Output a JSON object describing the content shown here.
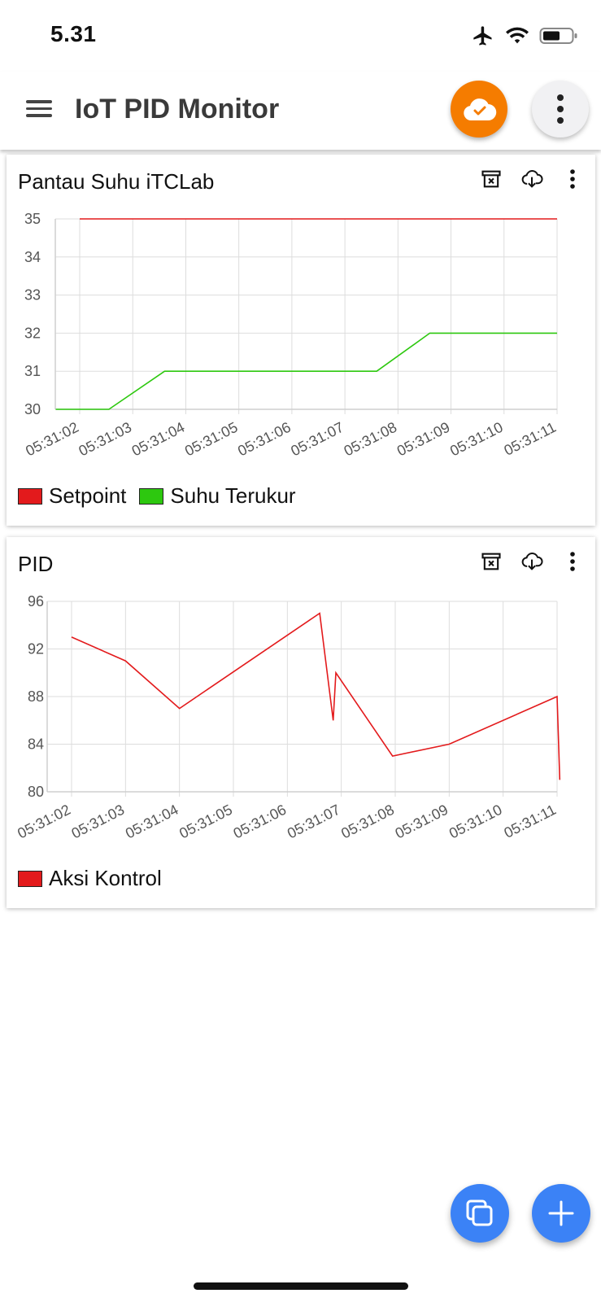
{
  "status": {
    "time": "5.31"
  },
  "app_bar": {
    "title": "IoT PID Monitor"
  },
  "cards": [
    {
      "title": "Pantau Suhu iTCLab"
    },
    {
      "title": "PID"
    }
  ],
  "chart_data": [
    {
      "type": "line",
      "title": "Pantau Suhu iTCLab",
      "xlabel": "",
      "ylabel": "",
      "categories": [
        "05:31:02",
        "05:31:03",
        "05:31:04",
        "05:31:05",
        "05:31:06",
        "05:31:07",
        "05:31:08",
        "05:31:09",
        "05:31:10",
        "05:31:11"
      ],
      "y_ticks": [
        30,
        31,
        32,
        33,
        34,
        35
      ],
      "ylim": [
        30,
        35
      ],
      "grid": true,
      "legend": "bottom-left",
      "series": [
        {
          "name": "Setpoint",
          "color": "#e31a1c",
          "points": [
            [
              "05:31:02",
              35
            ],
            [
              "05:31:11",
              35
            ]
          ]
        },
        {
          "name": "Suhu Terukur",
          "color": "#2dc80f",
          "points": [
            [
              "05:31:01.55",
              30
            ],
            [
              "05:31:02.55",
              30
            ],
            [
              "05:31:03.6",
              31
            ],
            [
              "05:31:07.6",
              31
            ],
            [
              "05:31:08.6",
              32
            ],
            [
              "05:31:11",
              32
            ]
          ]
        }
      ]
    },
    {
      "type": "line",
      "title": "PID",
      "xlabel": "",
      "ylabel": "",
      "categories": [
        "05:31:02",
        "05:31:03",
        "05:31:04",
        "05:31:05",
        "05:31:06",
        "05:31:07",
        "05:31:08",
        "05:31:09",
        "05:31:10",
        "05:31:11"
      ],
      "y_ticks": [
        80,
        84,
        88,
        92,
        96
      ],
      "ylim": [
        80,
        96
      ],
      "grid": true,
      "legend": "bottom-left",
      "series": [
        {
          "name": "Aksi Kontrol",
          "color": "#e31a1c",
          "points": [
            [
              "05:31:02",
              93
            ],
            [
              "05:31:03",
              91
            ],
            [
              "05:31:04",
              87
            ],
            [
              "05:31:06.6",
              95
            ],
            [
              "05:31:06.85",
              86
            ],
            [
              "05:31:06.9",
              90
            ],
            [
              "05:31:07.95",
              83
            ],
            [
              "05:31:09",
              84
            ],
            [
              "05:31:11",
              88
            ],
            [
              "05:31:11.05",
              81
            ]
          ]
        }
      ]
    }
  ]
}
